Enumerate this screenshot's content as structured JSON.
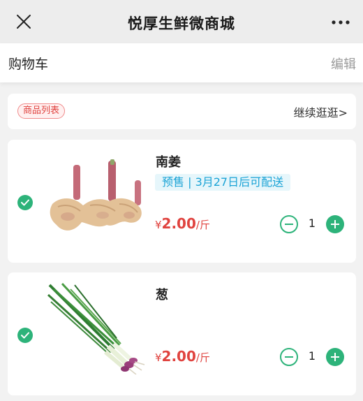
{
  "window": {
    "title": "悦厚生鲜微商城",
    "close_icon": "close-icon",
    "more_icon": "more-dots-icon"
  },
  "cart": {
    "title": "购物车",
    "edit_label": "编辑"
  },
  "product_list": {
    "tag": "商品列表",
    "continue_label": "继续逛逛>"
  },
  "items": [
    {
      "name": "南姜",
      "presale": "预售 | 3月27日后可配送",
      "currency": "¥",
      "price": "2.00",
      "unit": "/斤",
      "quantity": "1",
      "checked": true,
      "image": "galangal"
    },
    {
      "name": "葱",
      "currency": "¥",
      "price": "2.00",
      "unit": "/斤",
      "quantity": "1",
      "checked": true,
      "image": "scallion"
    }
  ],
  "colors": {
    "accent_green": "#2db37a",
    "price_red": "#e0433f",
    "presale_blue": "#1aa3d6"
  }
}
